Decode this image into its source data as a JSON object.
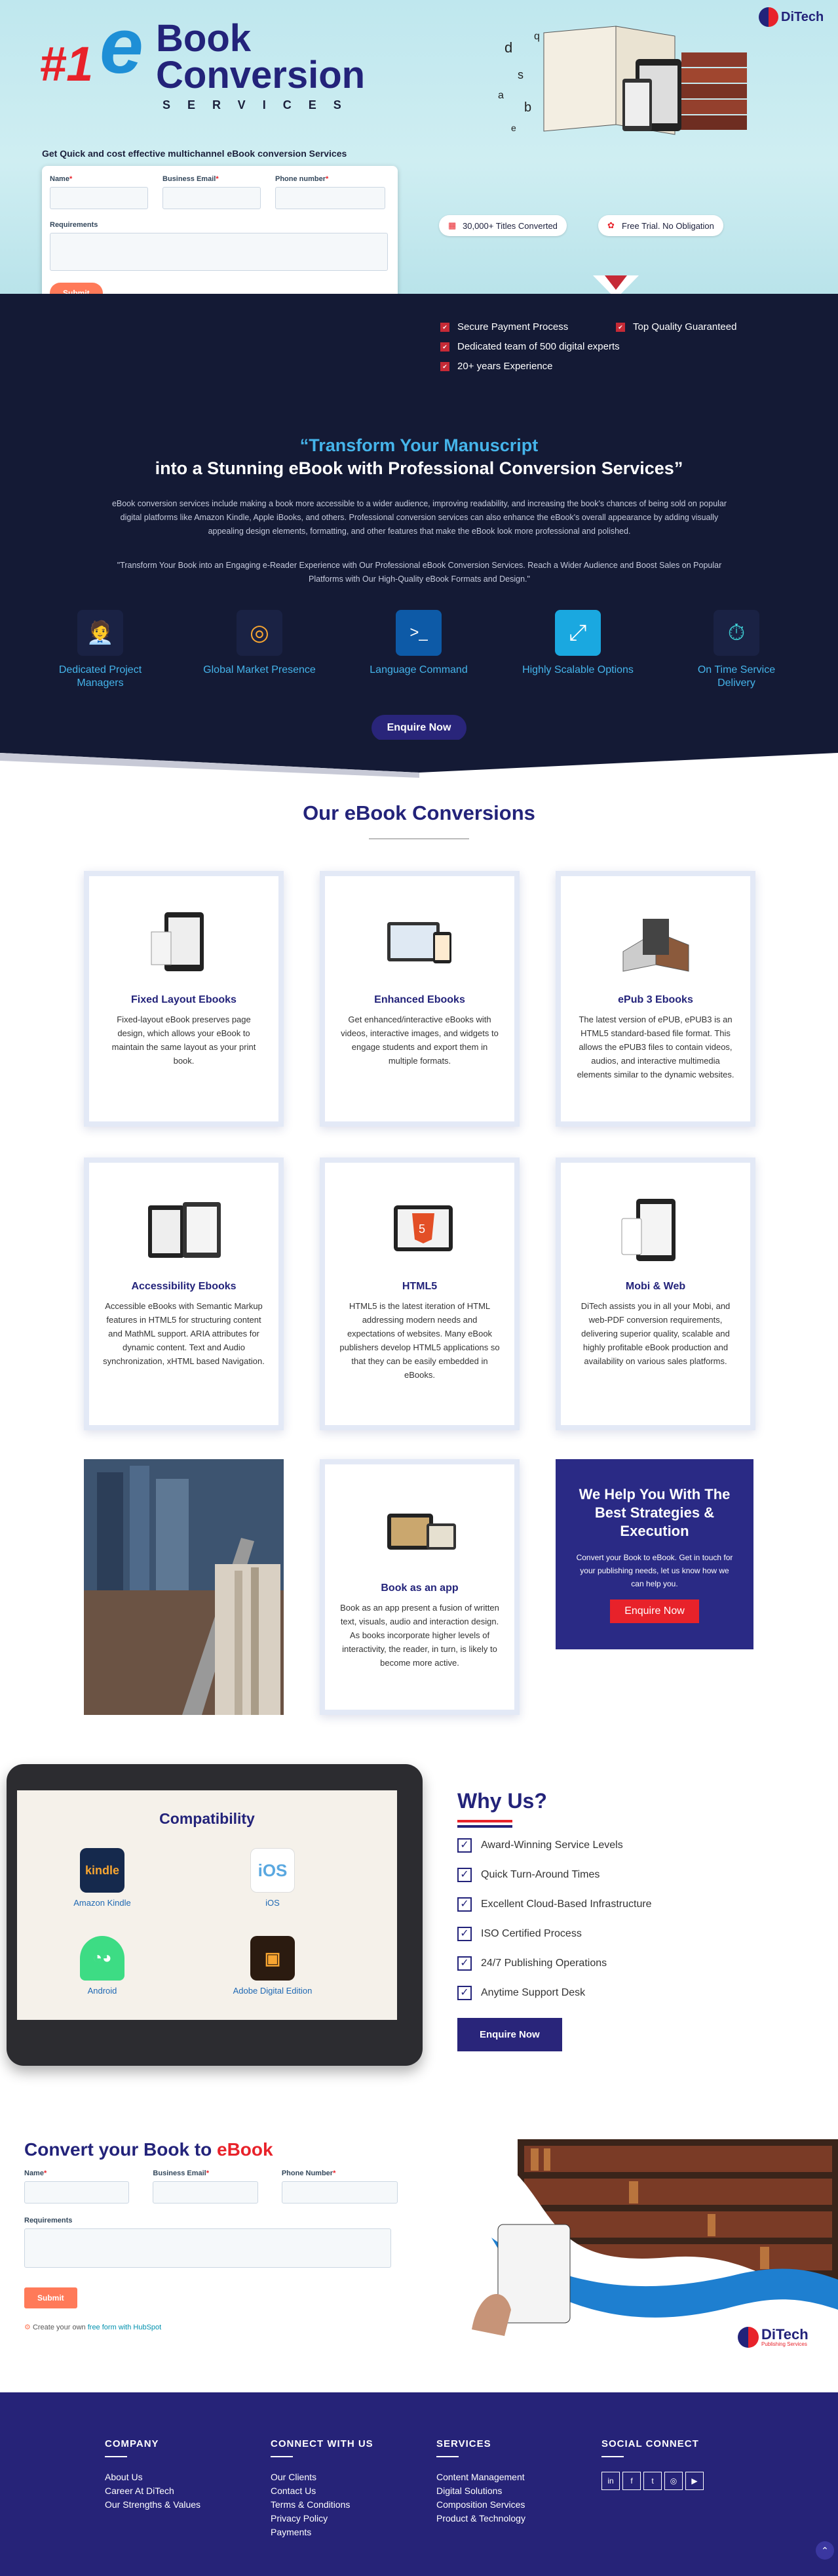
{
  "hero": {
    "brand": "DiTech",
    "rank": "#1",
    "e": "e",
    "line1": "Book",
    "line2": "Conversion",
    "line3": "SERVICES",
    "subtitle": "Get Quick and cost effective multichannel eBook conversion Services"
  },
  "form": {
    "name": "Name",
    "email": "Business Email",
    "phone": "Phone number",
    "requirements": "Requirements",
    "submit": "Submit",
    "hubspot_prefix": "Create your own",
    "hubspot_link": "free form with HubSpot"
  },
  "pills": [
    "30,000+ Titles Converted",
    "Free Trial. No Obligation"
  ],
  "features": [
    "Secure Payment Process",
    "Top Quality Guaranteed",
    "Dedicated team of 500 digital experts",
    "20+ years Experience"
  ],
  "intro": {
    "line1": "“Transform Your Manuscript",
    "line2": "into a Stunning eBook with Professional Conversion Services”",
    "p1": "eBook conversion services include making a book more accessible to a wider audience, improving readability, and increasing the book's chances of being sold on popular digital platforms like Amazon Kindle, Apple iBooks, and others. Professional conversion services can also enhance the eBook's overall appearance by adding visually appealing design elements, formatting, and other features that make the eBook look more professional and polished.",
    "p2": "\"Transform Your Book into an Engaging e-Reader Experience with Our Professional eBook Conversion Services. Reach a Wider Audience and Boost Sales on Popular Platforms with Our High-Quality eBook Formats and Design.\""
  },
  "icons": [
    {
      "label": "Dedicated Project Managers",
      "icon": "manager-icon"
    },
    {
      "label": "Global Market Presence",
      "icon": "globe-icon"
    },
    {
      "label": "Language Command",
      "icon": "terminal-icon"
    },
    {
      "label": "Highly Scalable Options",
      "icon": "scale-icon"
    },
    {
      "label": "On Time Service Delivery",
      "icon": "stopwatch-icon"
    }
  ],
  "enquire": "Enquire Now",
  "conversions": {
    "title": "Our eBook Conversions",
    "cards": [
      {
        "title": "Fixed Layout Ebooks",
        "text": "Fixed-layout eBook preserves page design, which allows your eBook to maintain the same layout as your print book."
      },
      {
        "title": "Enhanced Ebooks",
        "text": "Get enhanced/interactive eBooks with videos, interactive images, and widgets to engage students and export them in multiple formats."
      },
      {
        "title": "ePub 3 Ebooks",
        "text": "The latest version of ePUB, ePUB3 is an HTML5 standard-based file format. This allows the ePUB3 files to contain videos, audios, and interactive multimedia elements similar to the dynamic websites."
      },
      {
        "title": "Accessibility Ebooks",
        "text": "Accessible eBooks with Semantic Markup features in HTML5 for structuring content and MathML support. ARIA attributes for dynamic content. Text and Audio synchronization, xHTML based Navigation."
      },
      {
        "title": "HTML5",
        "text": "HTML5 is the latest iteration of HTML addressing modern needs and expectations of websites. Many eBook publishers develop HTML5 applications so that they can be easily embedded in eBooks."
      },
      {
        "title": "Mobi & Web",
        "text": "DiTech assists you in all your Mobi, and web-PDF conversion requirements, delivering superior quality, scalable and highly profitable eBook production and availability on various sales platforms."
      },
      {
        "title": "Book as an app",
        "text": "Book as an app present a fusion of written text, visuals, audio and interaction design. As books incorporate higher levels of interactivity, the reader, in turn, is likely to become more active."
      }
    ]
  },
  "help": {
    "title": "We Help You With The Best Strategies & Execution",
    "text": "Convert your Book to eBook. Get in touch for your publishing needs, let us know how we can help you.",
    "button": "Enquire Now"
  },
  "compat": {
    "title": "Compatibility",
    "items": [
      "Amazon Kindle",
      "iOS",
      "Android",
      "Adobe Digital Edition"
    ]
  },
  "why": {
    "title": "Why Us?",
    "items": [
      "Award-Winning Service Levels",
      "Quick Turn-Around Times",
      "Excellent Cloud-Based Infrastructure",
      "ISO Certified Process",
      "24/7 Publishing Operations",
      "Anytime Support Desk"
    ],
    "button": "Enquire Now"
  },
  "convert": {
    "title_a": "Convert your Book to",
    "title_b": "eBook",
    "name": "Name",
    "email": "Business Email",
    "phone": "Phone Number",
    "requirements": "Requirements",
    "submit": "Submit",
    "brand": "DiTech",
    "brand_sub": "Publishing Services"
  },
  "footer": {
    "company": {
      "title": "COMPANY",
      "links": [
        "About Us",
        "Career At DiTech",
        "Our Strengths & Values"
      ]
    },
    "connect": {
      "title": "CONNECT WITH US",
      "links": [
        "Our Clients",
        "Contact Us",
        "Terms & Conditions",
        "Privacy Policy",
        "Payments"
      ]
    },
    "services": {
      "title": "SERVICES",
      "links": [
        "Content Management",
        "Digital Solutions",
        "Composition Services",
        "Product & Technology"
      ]
    },
    "social": {
      "title": "SOCIAL CONNECT",
      "icons": [
        "linkedin-icon",
        "facebook-icon",
        "twitter-icon",
        "instagram-icon",
        "youtube-icon"
      ]
    }
  }
}
